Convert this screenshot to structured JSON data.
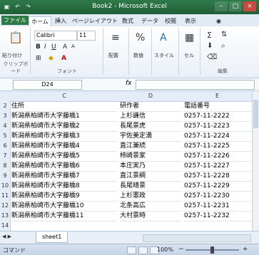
{
  "window": {
    "title": "Book2 - Microsoft Excel",
    "minimize_icon": "minimize-icon",
    "maximize_icon": "maximize-icon",
    "close_icon": "close-icon"
  },
  "quick_access": {
    "save_icon": "save-icon",
    "undo_icon": "undo-icon",
    "redo_icon": "redo-icon"
  },
  "tabs": [
    "ファイル",
    "ホーム",
    "挿入",
    "ページレイアウト",
    "数式",
    "データ",
    "校閲",
    "表示"
  ],
  "ribbon": {
    "clipboard": {
      "paste_label": "貼り付け",
      "label": "クリップボード"
    },
    "font": {
      "name": "Calibri",
      "size": "11",
      "label": "フォント",
      "bold": "B",
      "italic": "I",
      "underline": "U"
    },
    "alignment": {
      "label": "配置"
    },
    "number": {
      "label": "数値"
    },
    "styles": {
      "label": "スタイル"
    },
    "cells": {
      "label": "セル"
    },
    "editing": {
      "label": "編集"
    }
  },
  "formula_bar": {
    "name_box": "D24",
    "fx": "fx",
    "value": ""
  },
  "columns": [
    "C",
    "D",
    "E"
  ],
  "rows": [
    {
      "num": "2",
      "c": "住所",
      "d": "研作者",
      "e": "電話番号"
    },
    {
      "num": "3",
      "c": "新潟県柏崎市大字藤橋1",
      "d": "上杉謙信",
      "e": "0257-11-2222"
    },
    {
      "num": "4",
      "c": "新潟県柏崎市大字藤橋2",
      "d": "長尾景虎",
      "e": "0257-11-2223"
    },
    {
      "num": "5",
      "c": "新潟県柏崎市大字藤橋3",
      "d": "宇佐美定満",
      "e": "0257-11-2224"
    },
    {
      "num": "6",
      "c": "新潟県柏崎市大字藤橋4",
      "d": "直江兼続",
      "e": "0257-11-2225"
    },
    {
      "num": "7",
      "c": "新潟県柏崎市大字藤橋5",
      "d": "柿崎景家",
      "e": "0257-11-2226"
    },
    {
      "num": "8",
      "c": "新潟県柏崎市大字藤橋6",
      "d": "本庄実乃",
      "e": "0257-11-2227"
    },
    {
      "num": "9",
      "c": "新潟県柏崎市大字藤橋7",
      "d": "直江景綱",
      "e": "0257-11-2228"
    },
    {
      "num": "10",
      "c": "新潟県柏崎市大字藤橋8",
      "d": "長尾晴景",
      "e": "0257-11-2229"
    },
    {
      "num": "11",
      "c": "新潟県柏崎市大字藤橋9",
      "d": "上杉憲政",
      "e": "0257-11-2230"
    },
    {
      "num": "12",
      "c": "新潟県柏崎市大字藤橋10",
      "d": "北条高広",
      "e": "0257-11-2231"
    },
    {
      "num": "13",
      "c": "新潟県柏崎市大字藤橋11",
      "d": "大村景時",
      "e": "0257-11-2232"
    },
    {
      "num": "14",
      "c": "",
      "d": "",
      "e": ""
    }
  ],
  "sheet_tabs": [
    "sheet1"
  ],
  "status": {
    "left": "コマンド",
    "zoom": "100%"
  }
}
